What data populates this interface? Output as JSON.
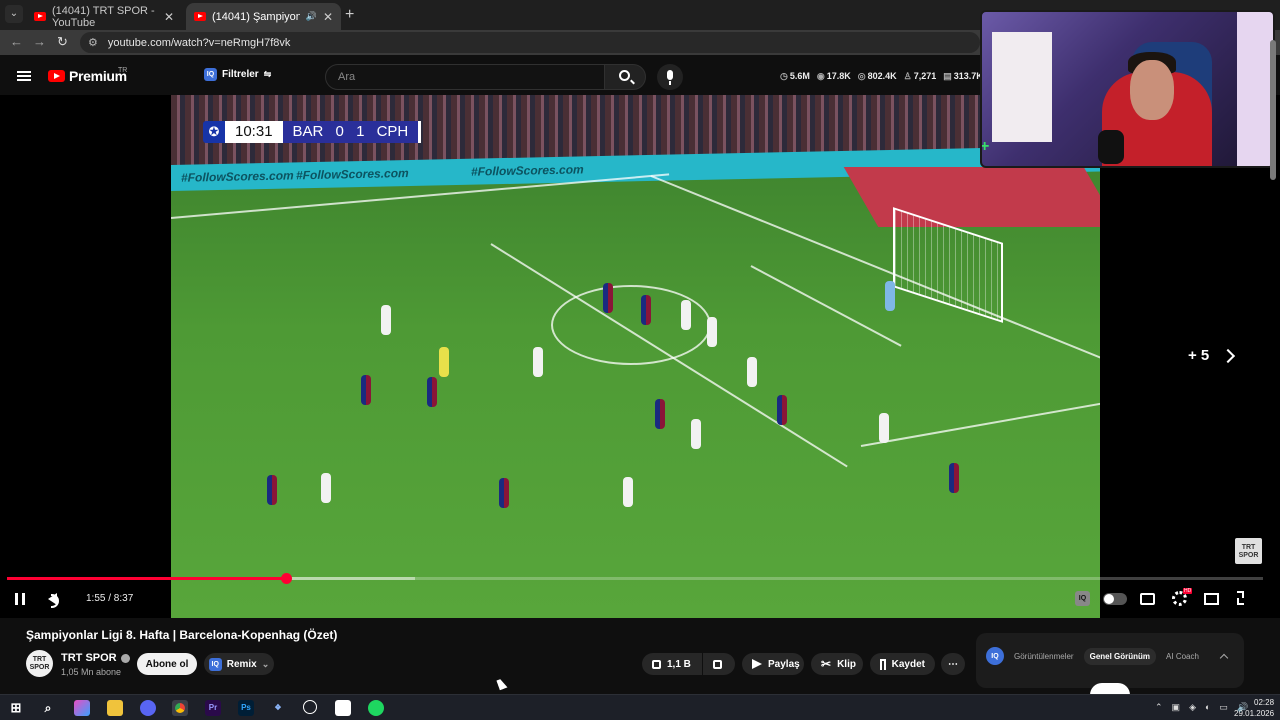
{
  "browser": {
    "tabs": [
      {
        "label": "(14041) TRT SPOR - YouTube",
        "active": false
      },
      {
        "label": "(14041) Şampiyonlar Ligi 8",
        "active": true
      }
    ],
    "url": "youtube.com/watch?v=neRmgH7f8vk",
    "new_tab": "+"
  },
  "header": {
    "logo_text": "Premium",
    "region": "TR",
    "filters_label": "Filtreler",
    "search_placeholder": "Ara",
    "stats": [
      "5.6M",
      "17.8K",
      "802.4K",
      "7,271",
      "313.7K"
    ]
  },
  "video": {
    "scorebug": {
      "time": "10:31",
      "teams": "BAR 0 1 CPH"
    },
    "adboard_text": "#FollowScores.com",
    "next_label": "+ 5",
    "watermark": "TRT SPOR",
    "timecode": "1:55 / 8:37",
    "progress_fraction": 0.222,
    "buffered_fraction": 0.325
  },
  "webcam_badge": "+",
  "meta": {
    "title": "Şampiyonlar Ligi 8. Hafta | Barcelona-Kopenhag (Özet)",
    "channel_name": "TRT SPOR",
    "channel_avatar": "TRT SPOR",
    "subscribers": "1,05 Mn abone",
    "subscribe_label": "Abone ol",
    "remix_label": "Remix",
    "like_count": "1,1 B",
    "share_label": "Paylaş",
    "clip_label": "Klip",
    "save_label": "Kaydet",
    "more_label": "⋯"
  },
  "side_panel": {
    "tabs": [
      "Görüntülenmeler",
      "Genel Görünüm",
      "AI Coach"
    ],
    "active_tab": "Genel Görünüm"
  },
  "taskbar": {
    "time": "02:28",
    "date": "29.01.2026"
  },
  "colors": {
    "accent": "#ff0033",
    "youtube_red": "#ff0000",
    "background": "#0f0f0f"
  }
}
